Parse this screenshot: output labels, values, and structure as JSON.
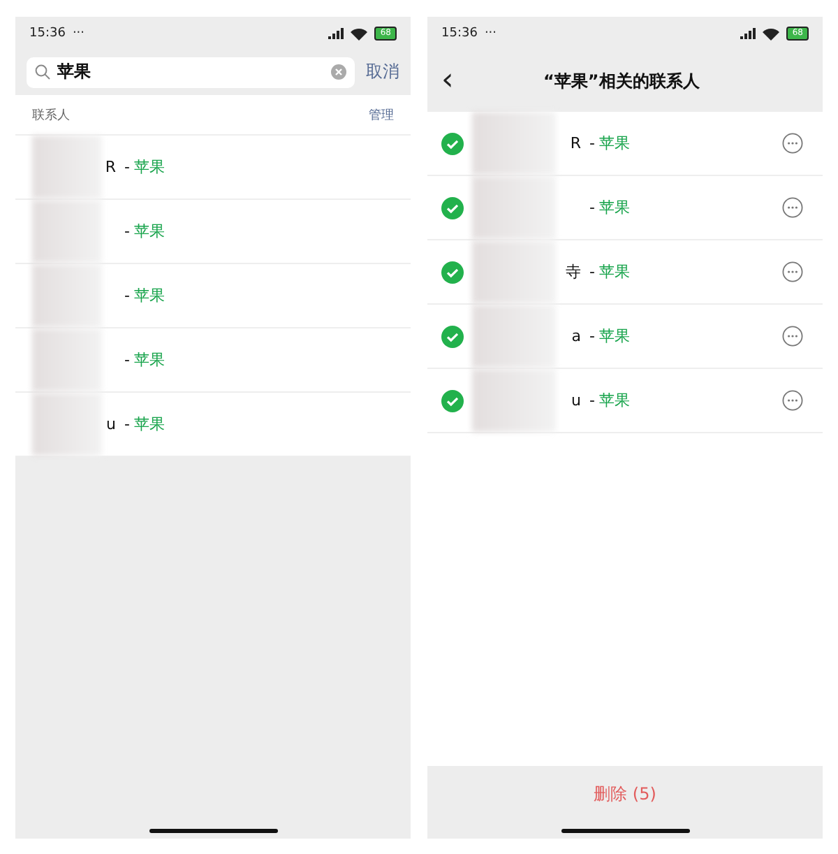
{
  "search_screen": {
    "status_bar": {
      "time": "15:36",
      "dots": "···",
      "battery": "68"
    },
    "search": {
      "value": "苹果",
      "cancel": "取消"
    },
    "section": {
      "title": "联系人",
      "action": "管理"
    },
    "results": [
      {
        "name_fragment": "R",
        "separator": "-",
        "keyword": "苹果"
      },
      {
        "separator": "-",
        "keyword": "苹果"
      },
      {
        "separator": "-",
        "keyword": "苹果"
      },
      {
        "separator": "-",
        "keyword": "苹果"
      },
      {
        "name_fragment": "u",
        "separator": "-",
        "keyword": "苹果"
      }
    ]
  },
  "contacts_screen": {
    "status_bar": {
      "time": "15:36",
      "dots": "···",
      "battery": "68"
    },
    "back": "‹",
    "title": "“苹果”相关的联系人",
    "contacts": [
      {
        "name_fragment": "R",
        "separator": "-",
        "keyword": "苹果",
        "checked": true
      },
      {
        "separator": "-",
        "keyword": "苹果",
        "checked": true
      },
      {
        "name_fragment": "寺",
        "separator": "-",
        "keyword": "苹果",
        "checked": true
      },
      {
        "name_fragment": "a",
        "separator": "-",
        "keyword": "苹果",
        "checked": true
      },
      {
        "name_fragment": "u",
        "separator": "-",
        "keyword": "苹果",
        "checked": true
      }
    ],
    "delete_button": "删除 (5)"
  }
}
